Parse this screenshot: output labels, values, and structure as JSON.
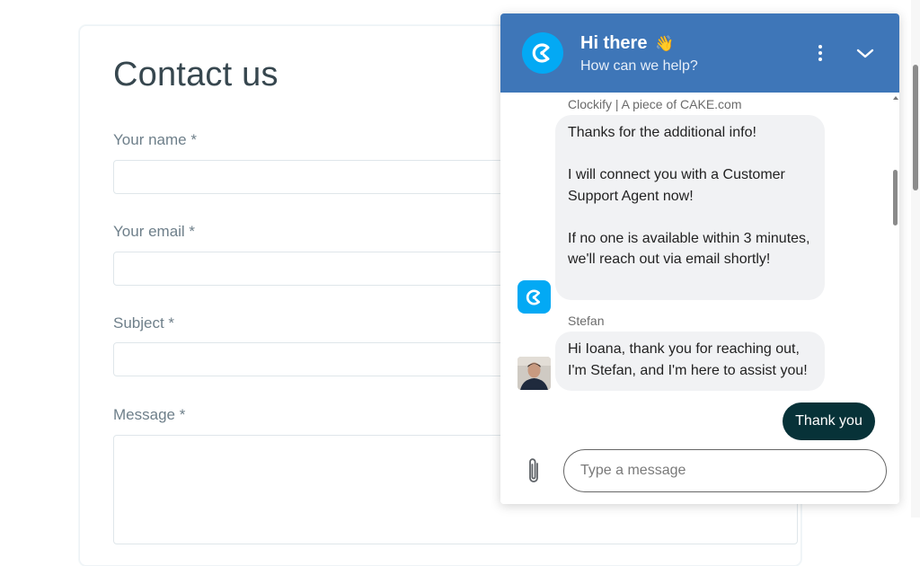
{
  "form": {
    "title": "Contact us",
    "fields": [
      {
        "label": "Your name *",
        "value": ""
      },
      {
        "label": "Your email *",
        "value": ""
      },
      {
        "label": "Subject *",
        "value": ""
      },
      {
        "label": "Message *",
        "value": ""
      }
    ]
  },
  "chat": {
    "header": {
      "title": "Hi there",
      "emoji": "👋",
      "subtitle": "How can we help?"
    },
    "messages": [
      {
        "sender": "Clockify | A piece of CAKE.com",
        "paragraphs": [
          "Thanks for the additional info!",
          "I will connect you with a Customer Support Agent now!",
          "If no one is available within 3 minutes, we'll reach out via email shortly!"
        ]
      },
      {
        "sender": "Stefan",
        "paragraphs": [
          "Hi Ioana, thank you for reaching out, I'm Stefan, and I'm here to assist you!"
        ]
      }
    ],
    "user_message": "Thank you",
    "input": {
      "placeholder": "Type a message",
      "value": ""
    }
  },
  "colors": {
    "header_bg": "#3e76b8",
    "brand_blue": "#03a9f4",
    "user_bubble": "#073238",
    "bot_bubble": "#f1f2f4"
  },
  "icons": {
    "brand": "clockify-logo-icon",
    "menu": "more-vertical-icon",
    "collapse": "chevron-down-icon",
    "attach": "paperclip-icon"
  }
}
